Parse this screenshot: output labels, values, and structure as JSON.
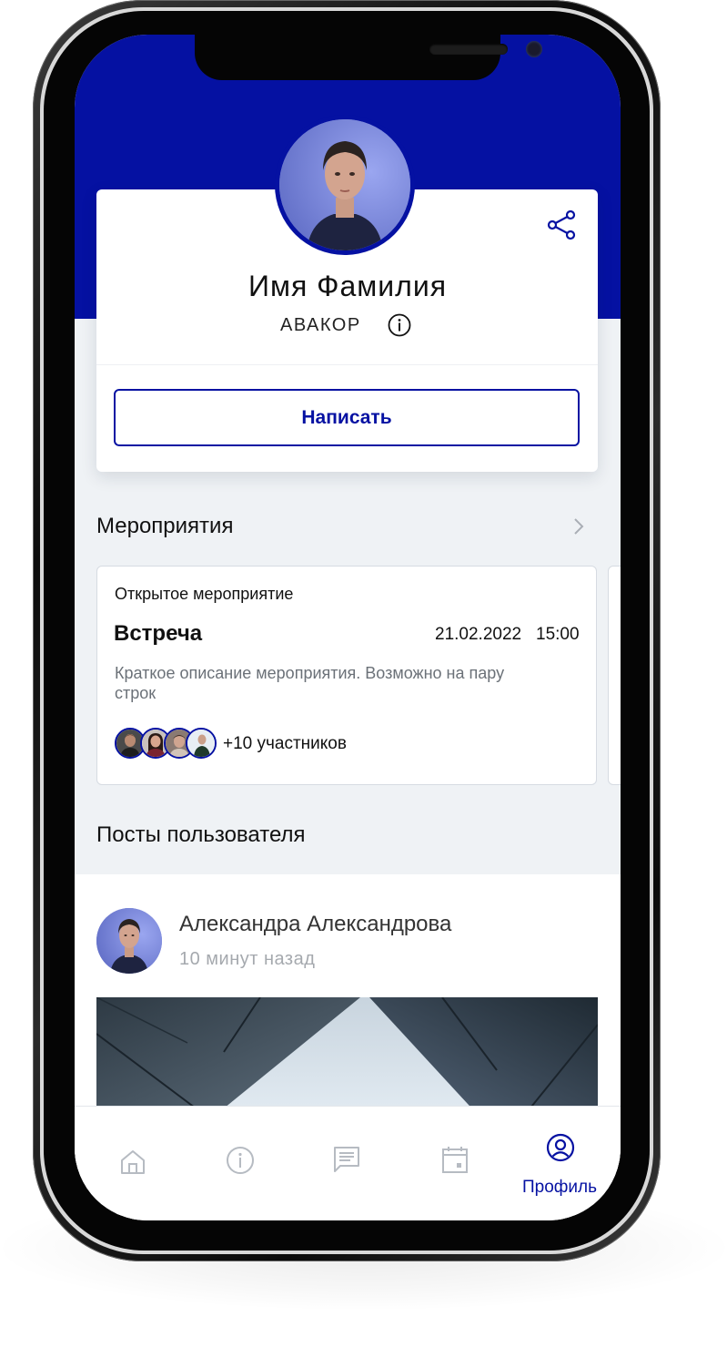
{
  "profile": {
    "name": "Имя Фамилия",
    "org": "АВАКОР",
    "write_button": "Написать"
  },
  "events": {
    "section_title": "Мероприятия",
    "card": {
      "type": "Открытое мероприятие",
      "title": "Встреча",
      "date": "21.02.2022",
      "time": "15:00",
      "description": "Краткое описание мероприятия. Возможно на пару строк",
      "participants": "+10 участников"
    }
  },
  "posts": {
    "section_title": "Посты пользователя",
    "post": {
      "author": "Александра Александрова",
      "time": "10 минут назад"
    }
  },
  "tabbar": {
    "items": [
      {
        "icon": "home-icon"
      },
      {
        "icon": "info-icon"
      },
      {
        "icon": "chat-icon"
      },
      {
        "icon": "calendar-icon"
      },
      {
        "icon": "profile-icon",
        "label": "Профиль",
        "active": true
      }
    ]
  },
  "colors": {
    "accent": "#0511a2",
    "background": "#eff2f5",
    "muted_text": "#a5a9ae"
  }
}
